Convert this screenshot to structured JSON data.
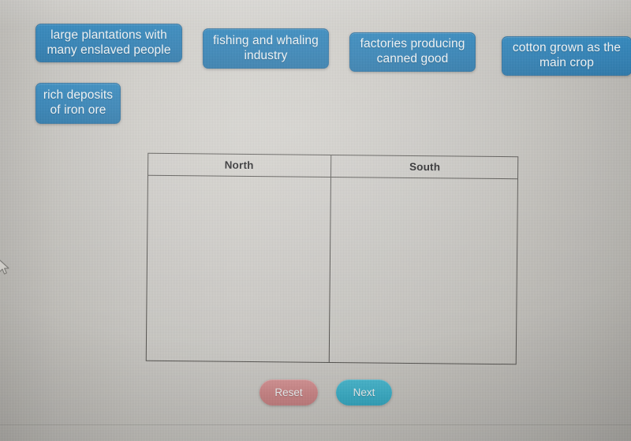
{
  "activity": {
    "type": "drag-and-drop-categorization",
    "tiles": [
      {
        "id": "tile-plantations",
        "label": "large plantations with many enslaved people"
      },
      {
        "id": "tile-fishing",
        "label": "fishing and whaling industry"
      },
      {
        "id": "tile-factories",
        "label": "factories producing canned good"
      },
      {
        "id": "tile-cotton",
        "label": "cotton grown as the main crop"
      },
      {
        "id": "tile-iron-ore",
        "label": "rich deposits of iron ore"
      }
    ],
    "table": {
      "columns": [
        {
          "id": "north",
          "label": "North",
          "items": []
        },
        {
          "id": "south",
          "label": "South",
          "items": []
        }
      ]
    },
    "buttons": {
      "reset_label": "Reset",
      "next_label": "Next"
    },
    "colors": {
      "tile_blue": "#2a7db3",
      "reset_red": "#c98384",
      "next_teal": "#38acc5",
      "table_border": "#53514e",
      "background_gray": "#cfcdc8"
    },
    "icons": {
      "pointer": "mouse-pointer-icon"
    }
  }
}
